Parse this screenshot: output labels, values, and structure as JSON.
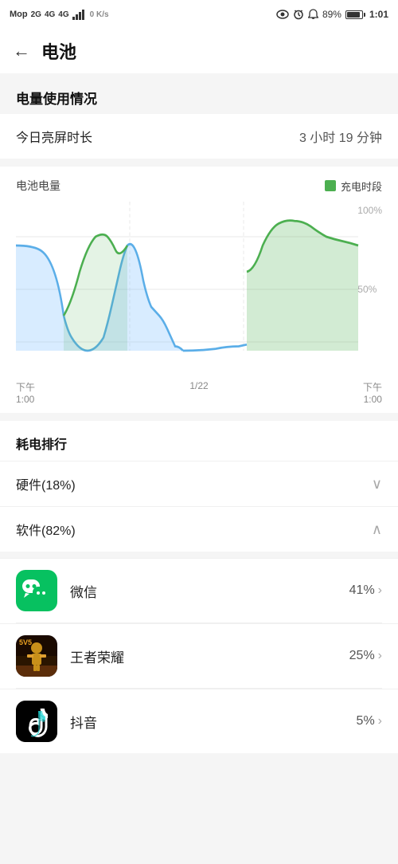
{
  "statusBar": {
    "left": {
      "brand": "Mop",
      "signal1": "2G",
      "signal2": "4G",
      "signal3": "4G",
      "wifi": "WiFi",
      "data": "0 K/s"
    },
    "right": {
      "eye": "👁",
      "alarm": "⏰",
      "bell": "🔔",
      "battery": "89%",
      "time": "1:01"
    }
  },
  "header": {
    "back": "←",
    "title": "电池"
  },
  "sectionTitle": "电量使用情况",
  "screenTime": {
    "label": "今日亮屏时长",
    "value": "3 小时 19 分钟"
  },
  "chart": {
    "leftLabel": "电池电量",
    "legendLabel": "充电时段",
    "yLabels": [
      "100%",
      "50%"
    ],
    "xLabels": [
      "下午\n1:00",
      "1/22",
      "下午\n1:00"
    ]
  },
  "rankingTitle": "耗电排行",
  "hardwareRow": {
    "label": "硬件(18%)",
    "chevron": "∨"
  },
  "softwareRow": {
    "label": "软件(82%)",
    "chevron": "∧"
  },
  "apps": [
    {
      "name": "微信",
      "percent": "41%",
      "type": "wechat"
    },
    {
      "name": "王者荣耀",
      "percent": "25%",
      "type": "honor"
    },
    {
      "name": "抖音",
      "percent": "5%",
      "type": "douyin"
    }
  ]
}
